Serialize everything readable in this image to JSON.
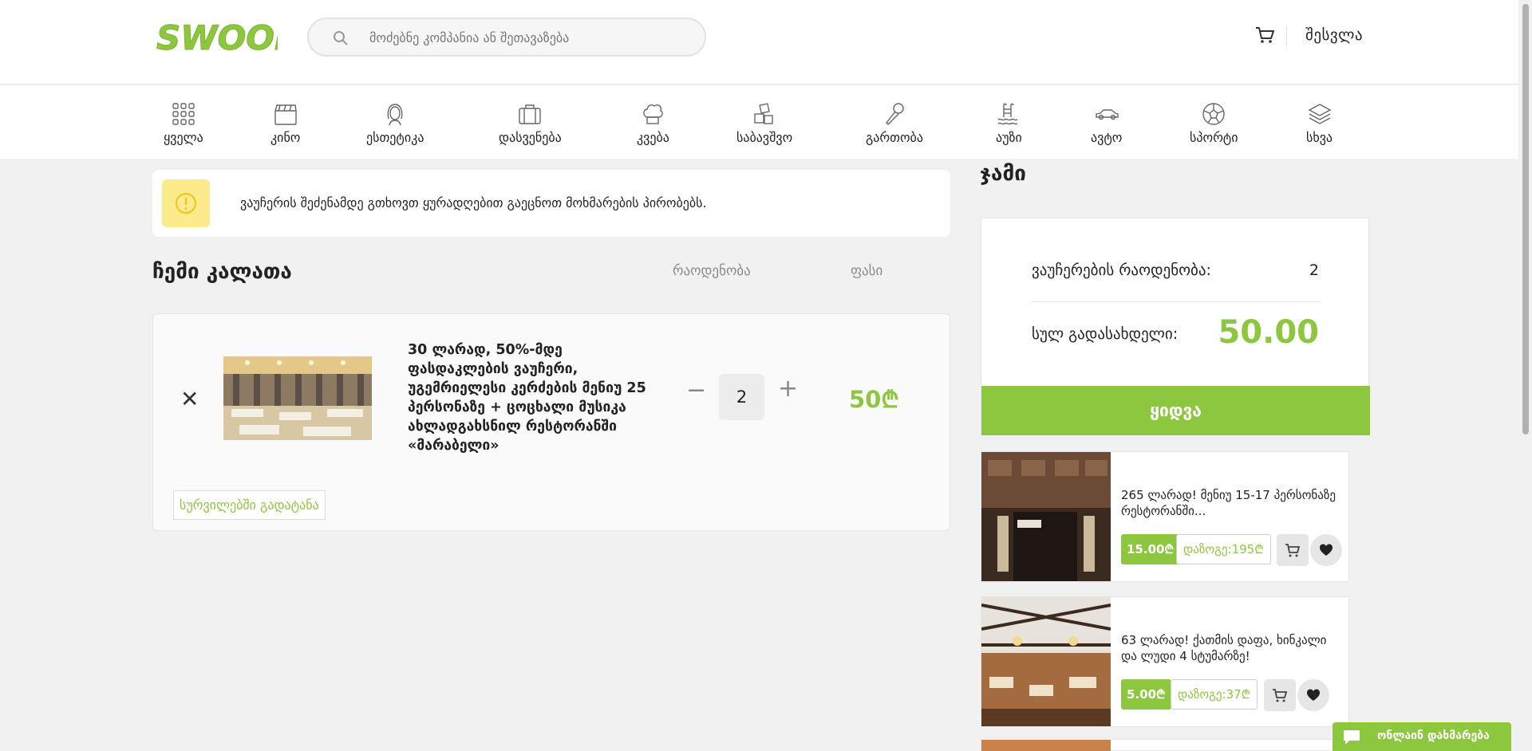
{
  "header": {
    "logo_text": "SWOOP",
    "search_placeholder": "მოძებნე კომპანია ან შეთავაზება",
    "login_label": "შესვლა"
  },
  "categories": [
    {
      "label": "ყველა",
      "icon": "grid-icon"
    },
    {
      "label": "კინო",
      "icon": "clapperboard-icon"
    },
    {
      "label": "ესთეტიკა",
      "icon": "face-icon"
    },
    {
      "label": "დასვენება",
      "icon": "suitcase-icon"
    },
    {
      "label": "კვება",
      "icon": "chef-hat-icon"
    },
    {
      "label": "საბავშვო",
      "icon": "toy-blocks-icon"
    },
    {
      "label": "გართობა",
      "icon": "microphone-icon"
    },
    {
      "label": "აუზი",
      "icon": "pool-icon"
    },
    {
      "label": "ავტო",
      "icon": "car-icon"
    },
    {
      "label": "სპორტი",
      "icon": "soccer-ball-icon"
    },
    {
      "label": "სხვა",
      "icon": "layers-icon"
    }
  ],
  "notice": {
    "text": "ვაუჩერის შეძენამდე გთხოვთ ყურადღებით გაეცნოთ მოხმარების პირობებს."
  },
  "cart": {
    "title": "ჩემი კალათა",
    "col_qty": "რაოდენობა",
    "col_price": "ფასი",
    "item": {
      "title": "30 ლარად, 50%-მდე ფასდაკლების ვაუჩერი, უგემრიელესი კერძების მენიუ 25 პერსონაზე + ცოცხალი მუსიკა ახლადგახსნილ რესტორანში «მარაბელი»",
      "quantity": "2",
      "minus": "−",
      "plus": "+",
      "remove": "✕",
      "price": "50₾",
      "wishlist_label": "სურვილებში გადატანა"
    }
  },
  "summary": {
    "title": "ჯამი",
    "count_label": "ვაუჩერების რაოდენობა:",
    "count_value": "2",
    "total_label": "სულ გადასახდელი:",
    "total_value": "50.00",
    "buy_label": "ყიდვა"
  },
  "offers": [
    {
      "text": "265 ლარად! მენიუ 15-17 პერსონაზე რესტორანში...",
      "price": "15.00₾",
      "save": "დაზოგე:195₾"
    },
    {
      "text": "63 ლარად! ქათმის დაფა, ხინკალი და ლუდი 4 სტუმარზე!",
      "price": "5.00₾",
      "save": "დაზოგე:37₾"
    }
  ],
  "chat": {
    "label": "ონლაინ დახმარება"
  },
  "colors": {
    "brand_green": "#8dc63f",
    "warning_yellow": "#fbeb8c"
  }
}
